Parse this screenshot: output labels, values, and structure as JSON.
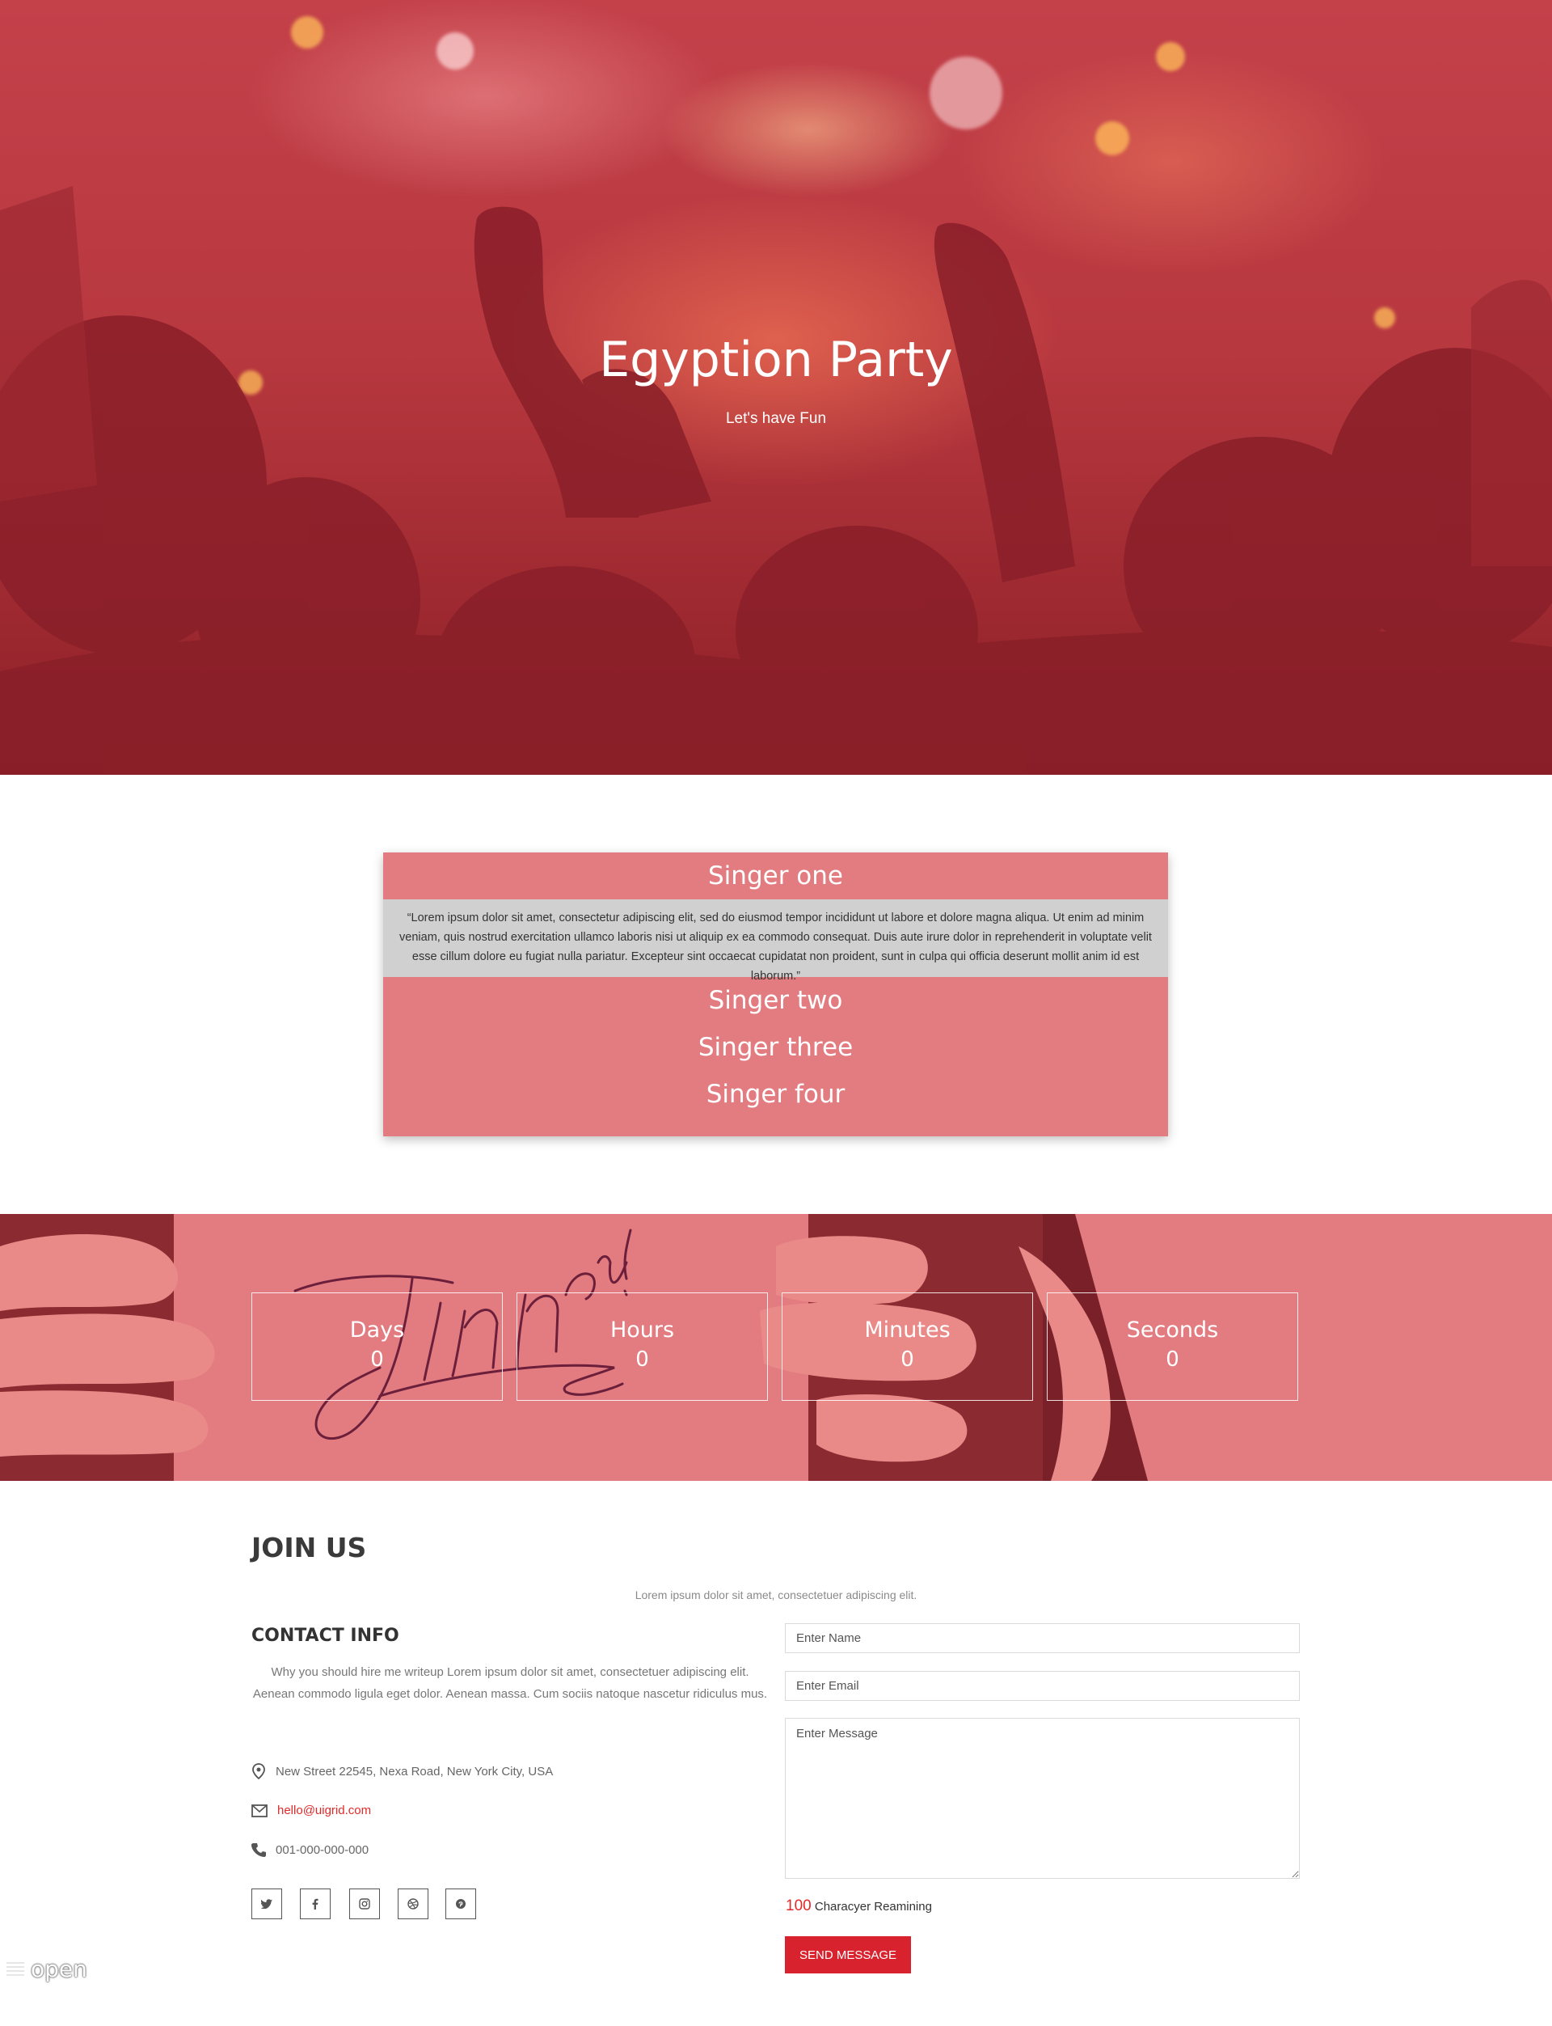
{
  "hero": {
    "title": "Egyption Party",
    "subtitle": "Let's have Fun"
  },
  "singers": {
    "items": [
      {
        "name": "Singer one",
        "expanded": true
      },
      {
        "name": "Singer two",
        "expanded": false
      },
      {
        "name": "Singer three",
        "expanded": false
      },
      {
        "name": "Singer four",
        "expanded": false
      }
    ],
    "open_text": "“Lorem ipsum dolor sit amet, consectetur adipiscing elit, sed do eiusmod tempor incididunt ut labore et dolore magna aliqua. Ut enim ad minim veniam, quis nostrud exercitation ullamco laboris nisi ut aliquip ex ea commodo consequat. Duis aute irure dolor in reprehenderit in voluptate velit esse cillum dolore eu fugiat nulla pariatur. Excepteur sint occaecat cupidatat non proident, sunt in culpa qui officia deserunt mollit anim id est laborum.”"
  },
  "countdown": {
    "days_label": "Days",
    "days_value": "0",
    "hours_label": "Hours",
    "hours_value": "0",
    "minutes_label": "Minutes",
    "minutes_value": "0",
    "seconds_label": "Seconds",
    "seconds_value": "0",
    "background_text": "Join us!"
  },
  "join": {
    "title": "JOIN US",
    "subtitle": "Lorem ipsum dolor sit amet, consectetuer adipiscing elit."
  },
  "contact": {
    "title": "CONTACT INFO",
    "text": "Why you should hire me writeup Lorem ipsum dolor sit amet, consectetuer adipiscing elit. Aenean commodo ligula eget dolor. Aenean massa. Cum sociis natoque nascetur ridiculus mus.",
    "address": "New Street 22545, Nexa Road, New York City, USA",
    "email": "hello@uigrid.com",
    "phone": "001-000-000-000",
    "social_icons": [
      "twitter-icon",
      "facebook-icon",
      "instagram-icon",
      "dribbble-icon",
      "pinterest-icon"
    ]
  },
  "form": {
    "name_placeholder": "Enter Name",
    "email_placeholder": "Enter Email",
    "message_placeholder": "Enter Message",
    "remaining_count": "100",
    "remaining_label": "Characyer Reamining",
    "send_label": "SEND MESSAGE"
  },
  "badge": {
    "label": "open"
  },
  "colors": {
    "accent": "#e37c80",
    "button": "#d8222e",
    "link": "#e02a2a"
  }
}
